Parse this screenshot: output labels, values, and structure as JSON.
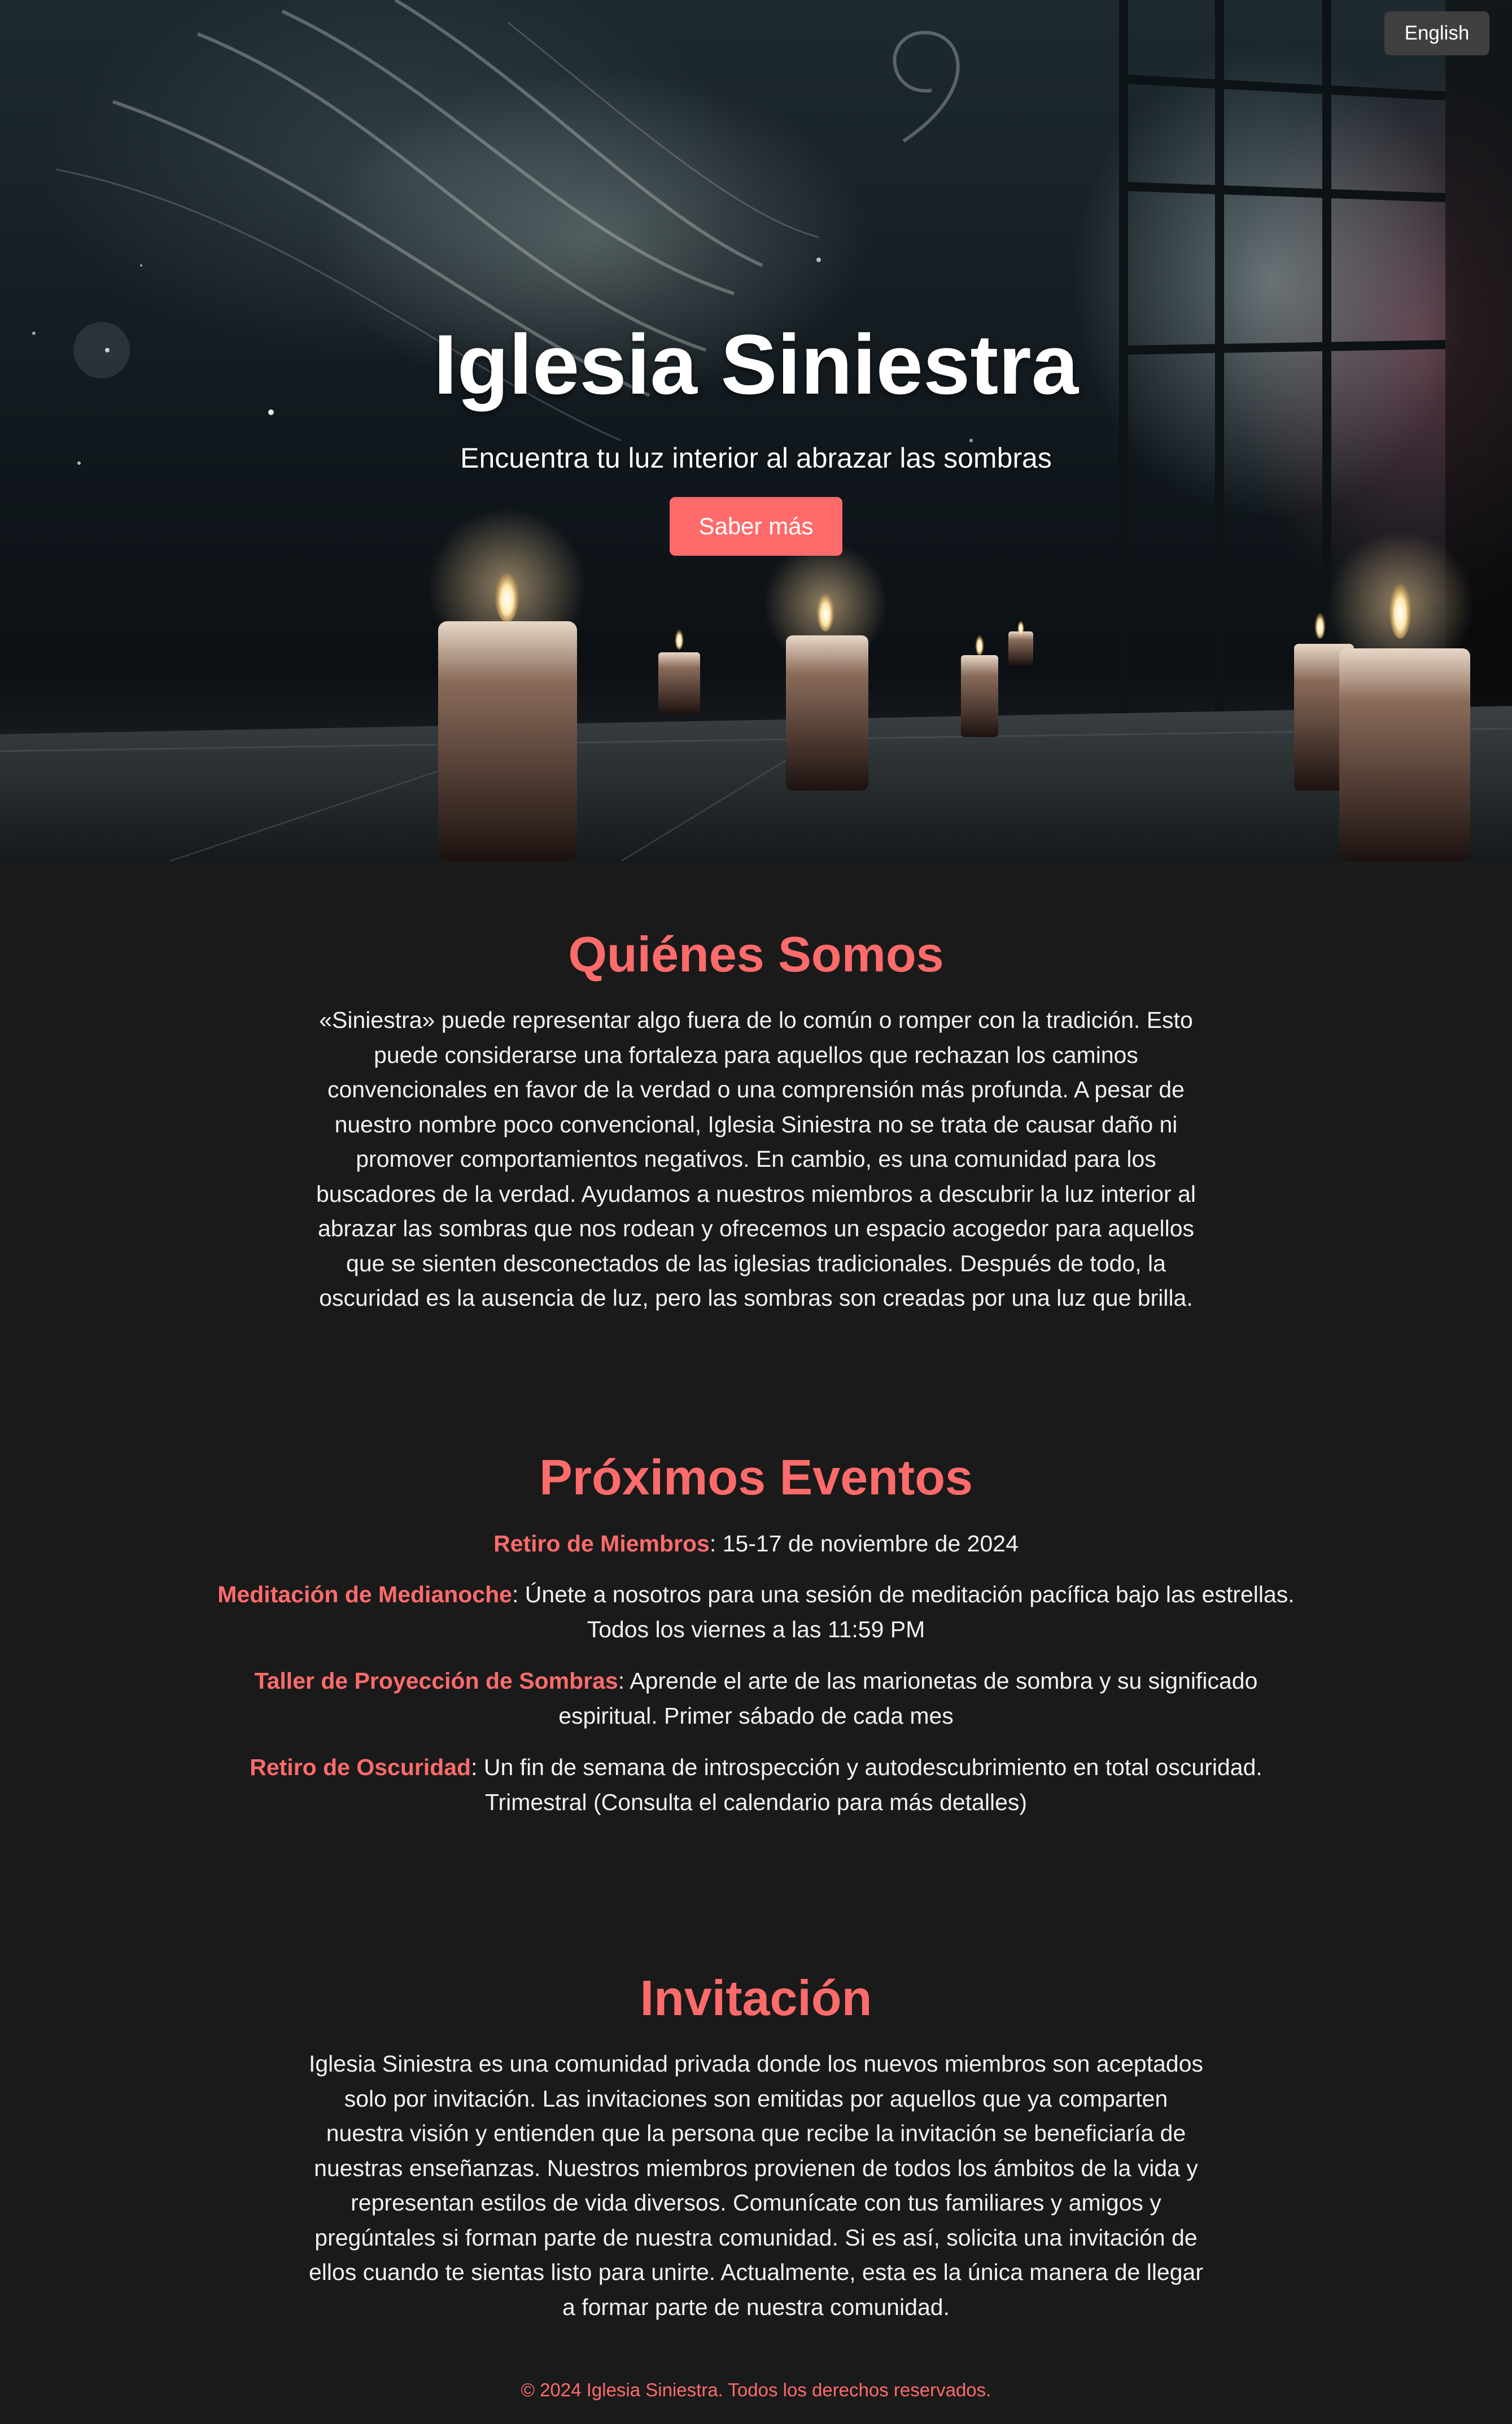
{
  "header": {
    "language_button": "English"
  },
  "hero": {
    "title": "Iglesia Siniestra",
    "subtitle": "Encuentra tu luz interior al abrazar las sombras",
    "cta_label": "Saber más"
  },
  "about": {
    "title": "Quiénes Somos",
    "text": "«Siniestra» puede representar algo fuera de lo común o romper con la tradición. Esto puede considerarse una fortaleza para aquellos que rechazan los caminos convencionales en favor de la verdad o una comprensión más profunda. A pesar de nuestro nombre poco convencional, Iglesia Siniestra no se trata de causar daño ni promover comportamientos negativos. En cambio, es una comunidad para los buscadores de la verdad. Ayudamos a nuestros miembros a descubrir la luz interior al abrazar las sombras que nos rodean y ofrecemos un espacio acogedor para aquellos que se sienten desconectados de las iglesias tradicionales. Después de todo, la oscuridad es la ausencia de luz, pero las sombras son creadas por una luz que brilla."
  },
  "events": {
    "title": "Próximos Eventos",
    "items": [
      {
        "name": "Retiro de Miembros",
        "detail": ": 15-17 de noviembre de 2024"
      },
      {
        "name": "Meditación de Medianoche",
        "detail": ": Únete a nosotros para una sesión de meditación pacífica bajo las estrellas. Todos los viernes a las 11:59 PM"
      },
      {
        "name": "Taller de Proyección de Sombras",
        "detail": ": Aprende el arte de las marionetas de sombra y su significado espiritual. Primer sábado de cada mes"
      },
      {
        "name": "Retiro de Oscuridad",
        "detail": ": Un fin de semana de introspección y autodescubrimiento en total oscuridad. Trimestral (Consulta el calendario para más detalles)"
      }
    ]
  },
  "invitation": {
    "title": "Invitación",
    "text": "Iglesia Siniestra es una comunidad privada donde los nuevos miembros son aceptados solo por invitación. Las invitaciones son emitidas por aquellos que ya comparten nuestra visión y entienden que la persona que recibe la invitación se beneficiaría de nuestras enseñanzas. Nuestros miembros provienen de todos los ámbitos de la vida y representan estilos de vida diversos. Comunícate con tus familiares y amigos y pregúntales si forman parte de nuestra comunidad. Si es así, solicita una invitación de ellos cuando te sientas listo para unirte. Actualmente, esta es la única manera de llegar a formar parte de nuestra comunidad."
  },
  "footer": {
    "copyright": "© 2024 Iglesia Siniestra. Todos los derechos reservados."
  },
  "colors": {
    "accent": "#ff6b6b",
    "background": "#1a1a1a",
    "language_button_bg": "#3f3f3f"
  }
}
